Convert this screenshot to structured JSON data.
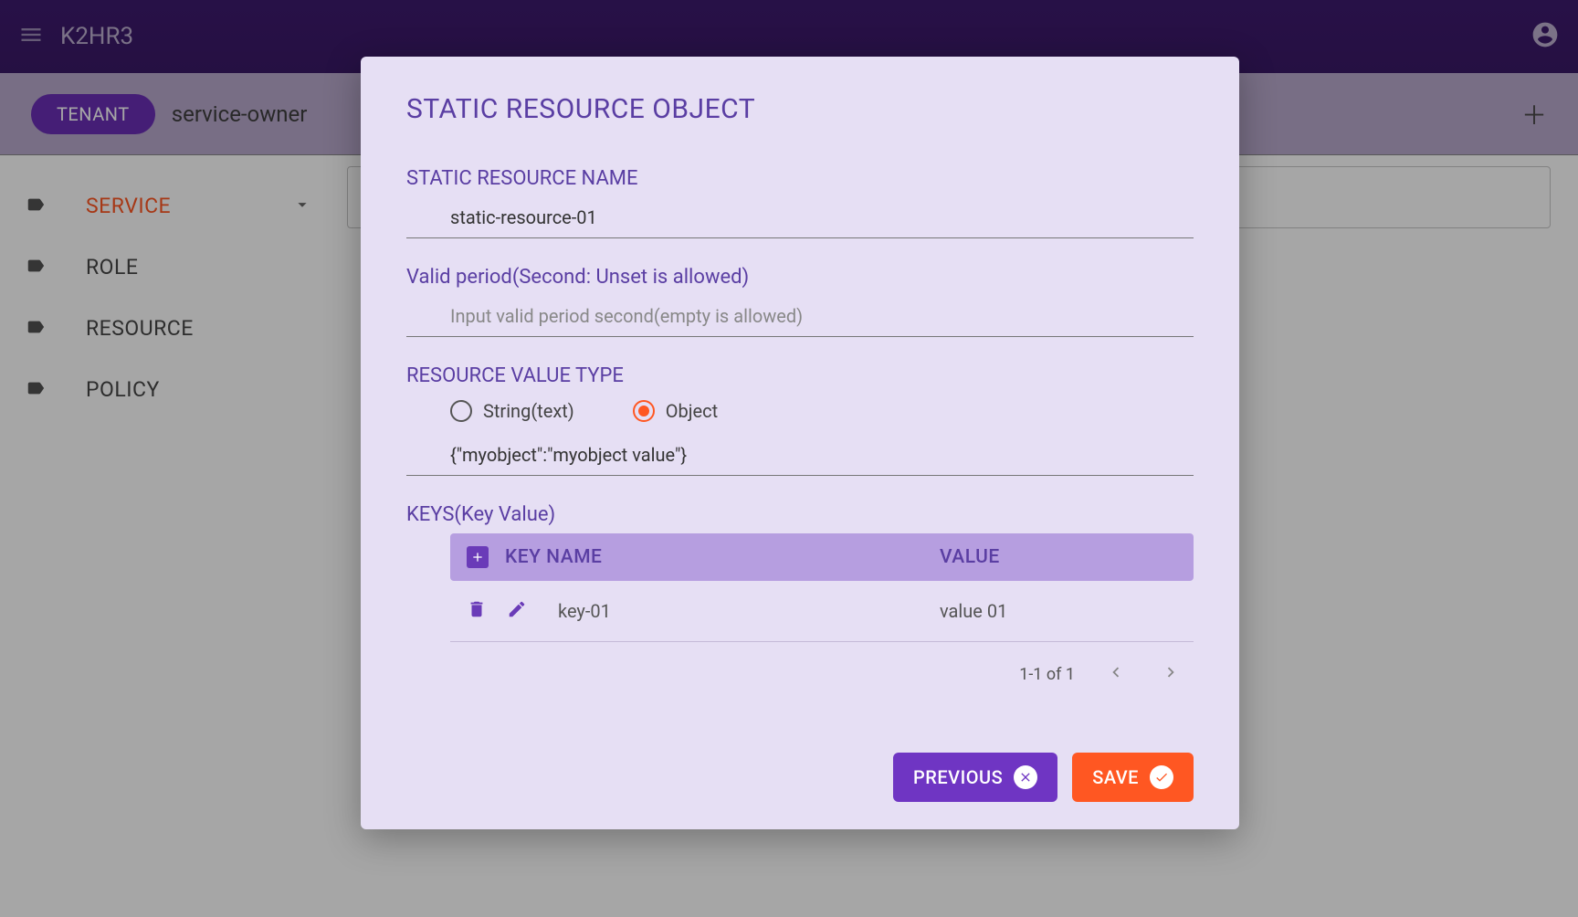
{
  "header": {
    "app_title": "K2HR3"
  },
  "subheader": {
    "tenant_chip": "TENANT",
    "tenant_name": "service-owner"
  },
  "sidebar": {
    "items": [
      {
        "label": "SERVICE",
        "active": true,
        "expandable": true
      },
      {
        "label": "ROLE",
        "active": false,
        "expandable": false
      },
      {
        "label": "RESOURCE",
        "active": false,
        "expandable": false
      },
      {
        "label": "POLICY",
        "active": false,
        "expandable": false
      }
    ]
  },
  "modal": {
    "title": "STATIC RESOURCE OBJECT",
    "name_label": "STATIC RESOURCE NAME",
    "name_value": "static-resource-01",
    "period_label": "Valid period(Second: Unset is allowed)",
    "period_placeholder": "Input valid period second(empty is allowed)",
    "period_value": "",
    "value_type_label": "RESOURCE VALUE TYPE",
    "radio_string": "String(text)",
    "radio_object": "Object",
    "object_value": "{\"myobject\":\"myobject value\"}",
    "keys_label": "KEYS(Key Value)",
    "keys_header_name": "KEY NAME",
    "keys_header_value": "VALUE",
    "keys_rows": [
      {
        "name": "key-01",
        "value": "value 01"
      }
    ],
    "pagination": "1-1 of 1",
    "btn_previous": "PREVIOUS",
    "btn_save": "SAVE"
  }
}
